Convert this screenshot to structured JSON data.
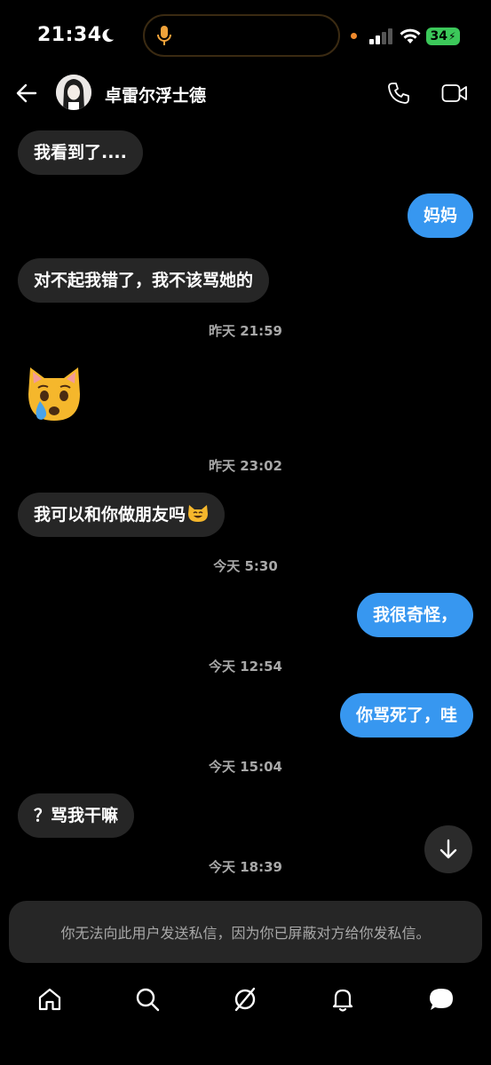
{
  "status_bar": {
    "time": "21:34",
    "battery": "34"
  },
  "header": {
    "contact_name": "卓雷尔浮士德"
  },
  "messages": [
    {
      "type": "incoming",
      "text": "我看到了...."
    },
    {
      "type": "outgoing",
      "text": "妈妈"
    },
    {
      "type": "incoming",
      "text": "对不起我错了，我不该骂她的"
    },
    {
      "type": "timestamp",
      "text": "昨天 21:59"
    },
    {
      "type": "incoming_emoji",
      "emoji": "crying-cat-face"
    },
    {
      "type": "timestamp",
      "text": "昨天 23:02"
    },
    {
      "type": "incoming",
      "text": "我可以和你做朋友吗",
      "trailing_emoji": "smiling-cat-face"
    },
    {
      "type": "timestamp",
      "text": "今天 5:30"
    },
    {
      "type": "outgoing",
      "text": "我很奇怪，"
    },
    {
      "type": "timestamp",
      "text": "今天 12:54"
    },
    {
      "type": "outgoing",
      "text": "你骂死了，哇"
    },
    {
      "type": "timestamp",
      "text": "今天 15:04"
    },
    {
      "type": "incoming",
      "text": "？骂我干嘛"
    },
    {
      "type": "timestamp",
      "text": "今天 18:39"
    }
  ],
  "notice": {
    "text": "你无法向此用户发送私信，因为你已屏蔽对方给你发私信。"
  },
  "nav": {
    "items": [
      "home-icon",
      "search-icon",
      "explore-icon",
      "notifications-icon",
      "messages-icon"
    ]
  },
  "colors": {
    "background": "#000000",
    "incoming_bubble": "#262626",
    "outgoing_bubble": "#3797f0",
    "timestamp": "#a8a8a8",
    "battery": "#3cc85a"
  }
}
